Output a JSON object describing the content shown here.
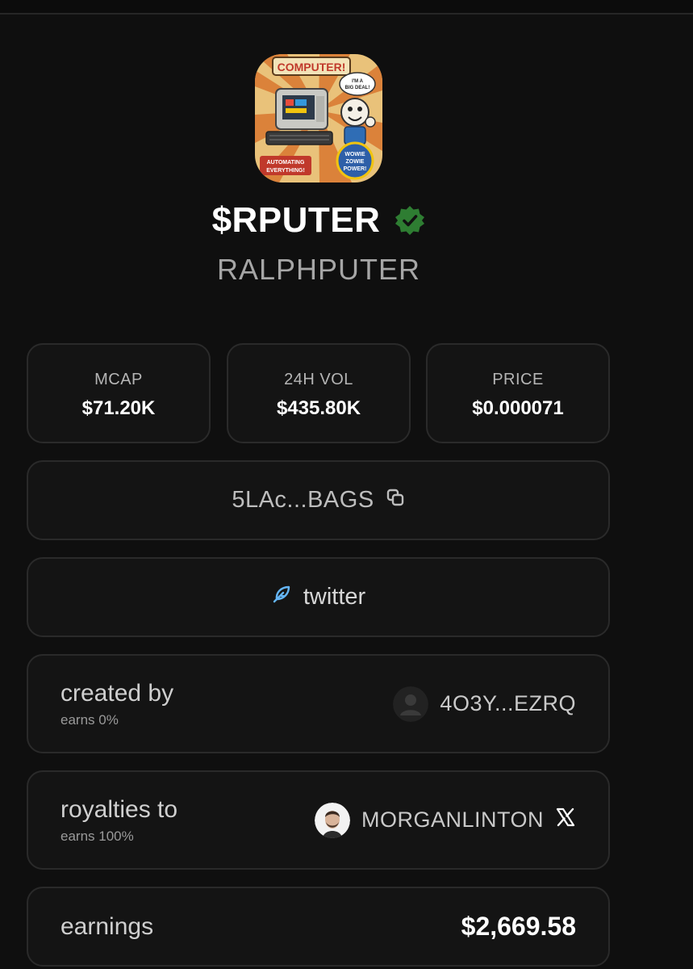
{
  "token": {
    "ticker": "$RPUTER",
    "name": "RALPHPUTER",
    "logo_text": {
      "banner": "COMPUTER!",
      "bubble_top": "I'M A",
      "bubble_bottom": "BIG DEAL!",
      "badge_left_1": "AUTOMATING",
      "badge_left_2": "EVERYTHING!",
      "badge_right_1": "WOWIE",
      "badge_right_2": "ZOWIE",
      "badge_right_3": "POWER!"
    }
  },
  "stats": [
    {
      "label": "MCAP",
      "value": "$71.20K"
    },
    {
      "label": "24H VOL",
      "value": "$435.80K"
    },
    {
      "label": "PRICE",
      "value": "$0.000071"
    }
  ],
  "contract": {
    "address": "5LAc...BAGS",
    "icon": "copy-icon"
  },
  "social": {
    "label": "twitter",
    "icon": "feather-icon"
  },
  "creator": {
    "title": "created by",
    "earns": "earns 0%",
    "wallet": "4O3Y...EZRQ"
  },
  "royalties": {
    "title": "royalties to",
    "earns": "earns 100%",
    "user": "MORGANLINTON",
    "icon": "x-icon"
  },
  "earnings": {
    "title": "earnings",
    "value": "$2,669.58"
  },
  "colors": {
    "background": "#0f0f0f",
    "card": "#141414",
    "border": "#2a2a2a",
    "verified": "#2e7d32",
    "accent_blue": "#64b5f6"
  }
}
